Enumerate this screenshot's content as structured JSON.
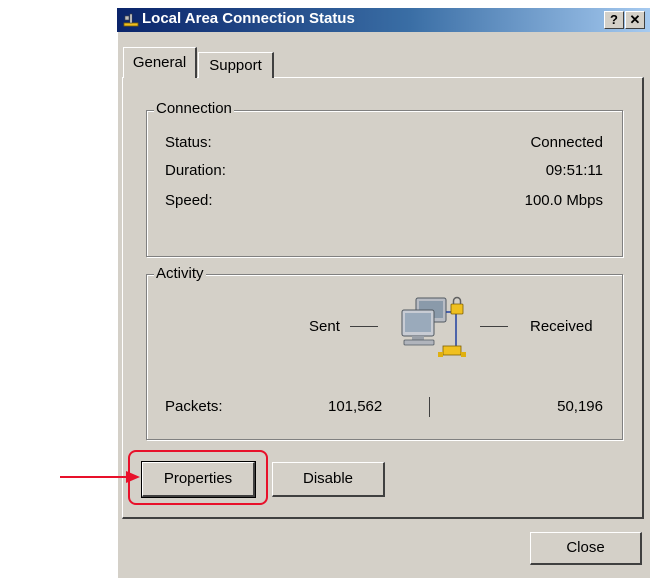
{
  "window": {
    "title": "Local Area Connection Status",
    "help_glyph": "?",
    "close_glyph": "✕"
  },
  "tabs": [
    {
      "label": "General",
      "selected": true
    },
    {
      "label": "Support",
      "selected": false
    }
  ],
  "connection": {
    "legend": "Connection",
    "rows": [
      {
        "label": "Status:",
        "value": "Connected"
      },
      {
        "label": "Duration:",
        "value": "09:51:11"
      },
      {
        "label": "Speed:",
        "value": "100.0 Mbps"
      }
    ]
  },
  "activity": {
    "legend": "Activity",
    "sent_label": "Sent",
    "received_label": "Received",
    "packets_label": "Packets:",
    "packets_sent": "101,562",
    "packets_received": "50,196",
    "icon": "network-computers-icon"
  },
  "buttons": {
    "properties": "Properties",
    "disable": "Disable",
    "close": "Close"
  },
  "colors": {
    "titlebar_start": "#0a246a",
    "titlebar_end": "#a6caf0",
    "dialog_face": "#d4d0c8",
    "highlight": "#e8102a"
  }
}
